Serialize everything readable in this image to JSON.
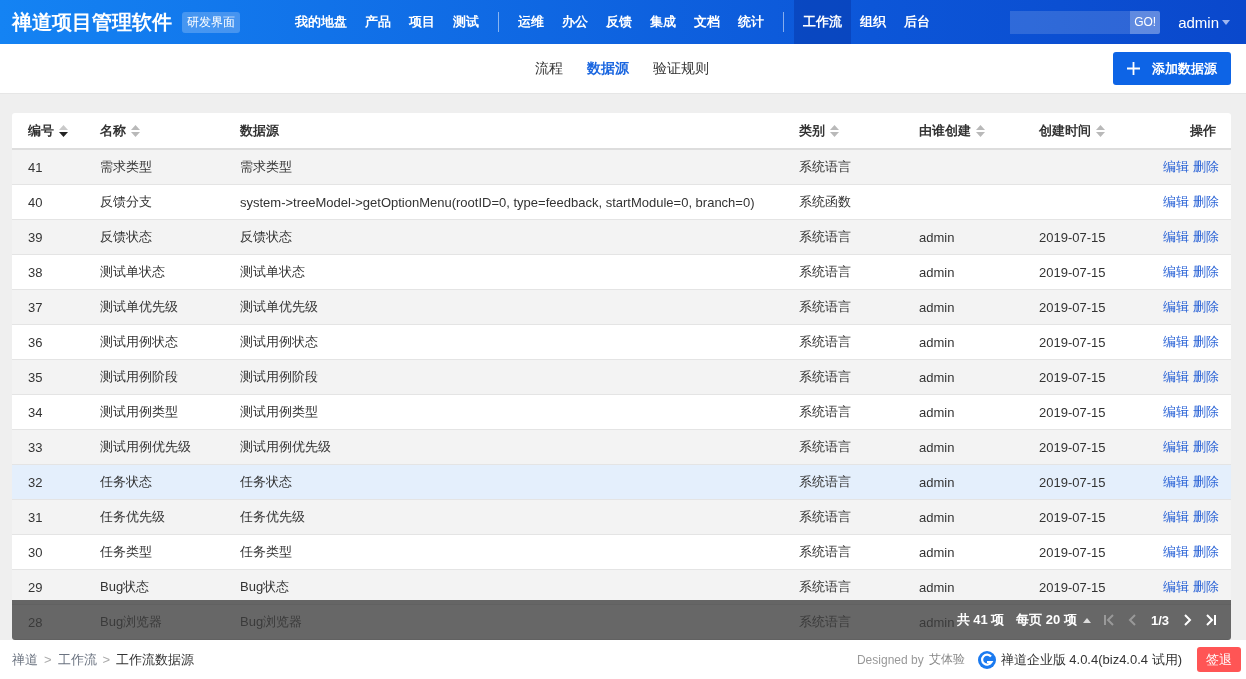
{
  "header": {
    "app_name": "禅道项目管理软件",
    "mode_badge": "研发界面",
    "nav_groups": [
      [
        {
          "label": "我的地盘",
          "selected": false
        },
        {
          "label": "产品",
          "selected": false
        },
        {
          "label": "项目",
          "selected": false
        },
        {
          "label": "测试",
          "selected": false
        }
      ],
      [
        {
          "label": "运维",
          "selected": false
        },
        {
          "label": "办公",
          "selected": false
        },
        {
          "label": "反馈",
          "selected": false
        },
        {
          "label": "集成",
          "selected": false
        },
        {
          "label": "文档",
          "selected": false
        },
        {
          "label": "统计",
          "selected": false
        }
      ],
      [
        {
          "label": "工作流",
          "selected": true
        },
        {
          "label": "组织",
          "selected": false
        },
        {
          "label": "后台",
          "selected": false
        }
      ]
    ],
    "search_button": "GO!",
    "user": "admin"
  },
  "subnav": {
    "tabs": [
      {
        "label": "流程",
        "selected": false
      },
      {
        "label": "数据源",
        "selected": true
      },
      {
        "label": "验证规则",
        "selected": false
      }
    ],
    "add_button": "添加数据源"
  },
  "table": {
    "columns": [
      {
        "label": "编号",
        "sorted": true
      },
      {
        "label": "名称",
        "sorted": false
      },
      {
        "label": "数据源"
      },
      {
        "label": "类别",
        "sorted": false
      },
      {
        "label": "由谁创建",
        "sorted": false
      },
      {
        "label": "创建时间",
        "sorted": false
      },
      {
        "label": "操作"
      }
    ],
    "rows": [
      {
        "id": "41",
        "name": "需求类型",
        "source": "需求类型",
        "type": "系统语言",
        "creator": "",
        "date": "",
        "actions": [
          "编辑",
          "删除"
        ],
        "selected": false
      },
      {
        "id": "40",
        "name": "反馈分支",
        "source": "system->treeModel->getOptionMenu(rootID=0, type=feedback, startModule=0, branch=0)",
        "type": "系统函数",
        "creator": "",
        "date": "",
        "actions": [
          "编辑",
          "删除"
        ],
        "selected": false
      },
      {
        "id": "39",
        "name": "反馈状态",
        "source": "反馈状态",
        "type": "系统语言",
        "creator": "admin",
        "date": "2019-07-15",
        "actions": [
          "编辑",
          "删除"
        ],
        "selected": false
      },
      {
        "id": "38",
        "name": "测试单状态",
        "source": "测试单状态",
        "type": "系统语言",
        "creator": "admin",
        "date": "2019-07-15",
        "actions": [
          "编辑",
          "删除"
        ],
        "selected": false
      },
      {
        "id": "37",
        "name": "测试单优先级",
        "source": "测试单优先级",
        "type": "系统语言",
        "creator": "admin",
        "date": "2019-07-15",
        "actions": [
          "编辑",
          "删除"
        ],
        "selected": false
      },
      {
        "id": "36",
        "name": "测试用例状态",
        "source": "测试用例状态",
        "type": "系统语言",
        "creator": "admin",
        "date": "2019-07-15",
        "actions": [
          "编辑",
          "删除"
        ],
        "selected": false
      },
      {
        "id": "35",
        "name": "测试用例阶段",
        "source": "测试用例阶段",
        "type": "系统语言",
        "creator": "admin",
        "date": "2019-07-15",
        "actions": [
          "编辑",
          "删除"
        ],
        "selected": false
      },
      {
        "id": "34",
        "name": "测试用例类型",
        "source": "测试用例类型",
        "type": "系统语言",
        "creator": "admin",
        "date": "2019-07-15",
        "actions": [
          "编辑",
          "删除"
        ],
        "selected": false
      },
      {
        "id": "33",
        "name": "测试用例优先级",
        "source": "测试用例优先级",
        "type": "系统语言",
        "creator": "admin",
        "date": "2019-07-15",
        "actions": [
          "编辑",
          "删除"
        ],
        "selected": false
      },
      {
        "id": "32",
        "name": "任务状态",
        "source": "任务状态",
        "type": "系统语言",
        "creator": "admin",
        "date": "2019-07-15",
        "actions": [
          "编辑",
          "删除"
        ],
        "selected": true
      },
      {
        "id": "31",
        "name": "任务优先级",
        "source": "任务优先级",
        "type": "系统语言",
        "creator": "admin",
        "date": "2019-07-15",
        "actions": [
          "编辑",
          "删除"
        ],
        "selected": false
      },
      {
        "id": "30",
        "name": "任务类型",
        "source": "任务类型",
        "type": "系统语言",
        "creator": "admin",
        "date": "2019-07-15",
        "actions": [
          "编辑",
          "删除"
        ],
        "selected": false
      },
      {
        "id": "29",
        "name": "Bug状态",
        "source": "Bug状态",
        "type": "系统语言",
        "creator": "admin",
        "date": "2019-07-15",
        "actions": [
          "编辑",
          "删除"
        ],
        "selected": false
      },
      {
        "id": "28",
        "name": "Bug浏览器",
        "source": "Bug浏览器",
        "type": "系统语言",
        "creator": "admin",
        "date": "",
        "actions": []
      }
    ]
  },
  "pager": {
    "total": "共 41 项",
    "per_page": "每页 20 项",
    "page": "1/3",
    "first_disabled": true,
    "prev_disabled": true,
    "next_disabled": false,
    "last_disabled": false
  },
  "footer": {
    "breadcrumb": [
      {
        "label": "禅道",
        "separator": ">"
      },
      {
        "label": "工作流",
        "separator": ">"
      },
      {
        "label": "工作流数据源"
      }
    ],
    "designed_by": "Designed by",
    "designer": "艾体验",
    "version": "禅道企业版 4.0.4(biz4.0.4 试用)",
    "logout": "签退"
  }
}
